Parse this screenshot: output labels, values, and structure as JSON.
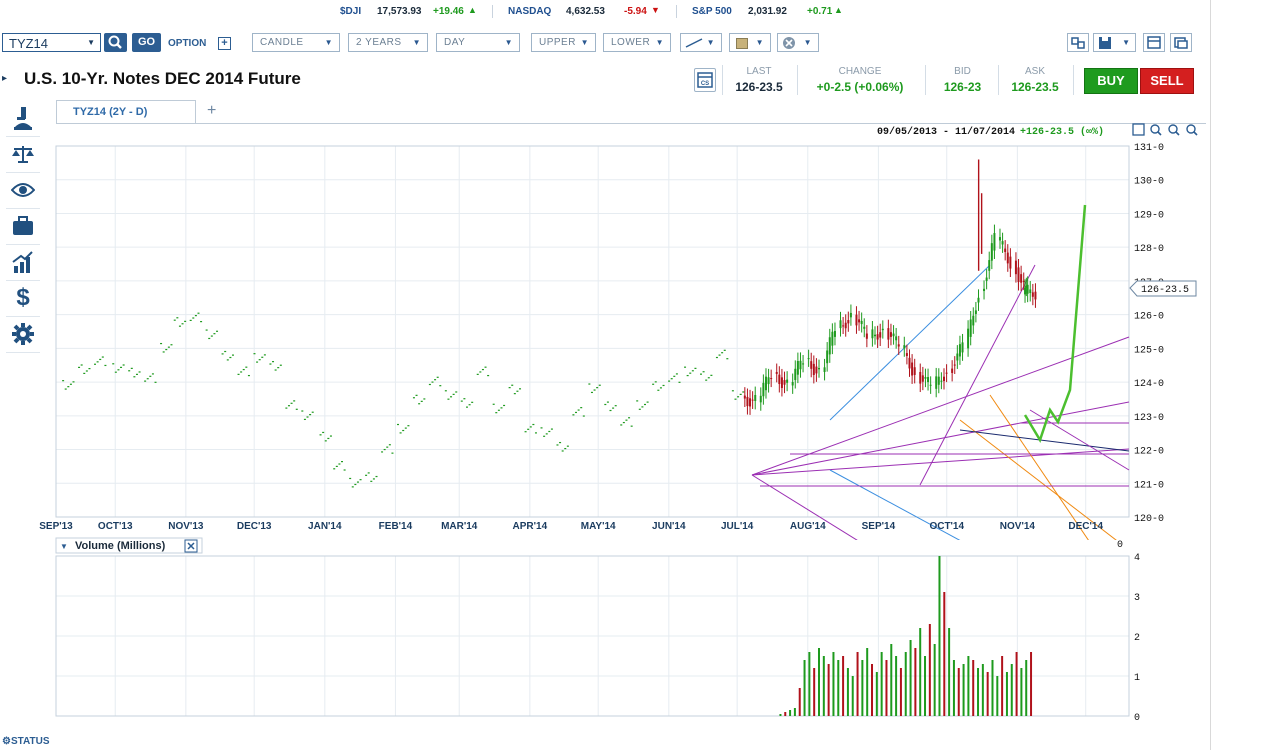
{
  "ticker": [
    {
      "name": "$DJI",
      "value": "17,573.93",
      "change": "+19.46",
      "dir": "up"
    },
    {
      "name": "NASDAQ",
      "value": "4,632.53",
      "change": "-5.94",
      "dir": "down"
    },
    {
      "name": "S&P 500",
      "value": "2,031.92",
      "change": "+0.71",
      "dir": "up"
    }
  ],
  "toolbar": {
    "symbol": "TYZ14",
    "go_label": "GO",
    "option_label": "OPTION",
    "chart_type": "CANDLE",
    "range": "2 YEARS",
    "interval": "DAY",
    "upper": "UPPER",
    "lower": "LOWER"
  },
  "instrument": {
    "title": "U.S. 10-Yr. Notes DEC 2014 Future",
    "last_label": "LAST",
    "last": "126-23.5",
    "change_label": "CHANGE",
    "change": "+0-2.5 (+0.06%)",
    "bid_label": "BID",
    "bid": "126-23",
    "ask_label": "ASK",
    "ask": "126-23.5",
    "buy_label": "BUY",
    "sell_label": "SELL",
    "cs_icon_label": "CS"
  },
  "tabs": {
    "active": "TYZ14 (2Y - D)",
    "add_label": "+"
  },
  "chart": {
    "date_range": "09/05/2013 - 11/07/2014",
    "last_change": "+126-23.5 (∞%)",
    "price_marker": "126-23.5",
    "y_ticks": [
      "131-0",
      "130-0",
      "129-0",
      "128-0",
      "127-0",
      "126-0",
      "125-0",
      "124-0",
      "123-0",
      "122-0",
      "121-0",
      "120-0"
    ],
    "x_ticks": [
      "SEP'13",
      "OCT'13",
      "NOV'13",
      "DEC'13",
      "JAN'14",
      "FEB'14",
      "MAR'14",
      "APR'14",
      "MAY'14",
      "JUN'14",
      "JUL'14",
      "AUG'14",
      "SEP'14",
      "OCT'14",
      "NOV'14",
      "DEC'14"
    ],
    "colors": {
      "up": "#1e9a1e",
      "down": "#b0121b",
      "buy": "#1f9b1f",
      "sell": "#d41f1f",
      "accent": "#2c5d92"
    }
  },
  "volume": {
    "title": "Volume (Millions)",
    "corner_value": "0",
    "y_ticks": [
      "4",
      "3",
      "2",
      "1",
      "0"
    ]
  },
  "status_label": "STATUS",
  "chart_data": [
    {
      "type": "candlestick",
      "title": "U.S. 10-Yr. Notes DEC 2014 Future",
      "ylim": [
        120,
        131
      ],
      "xlim": [
        "2013-09-05",
        "2014-12-20"
      ],
      "x_ticks": [
        "SEP'13",
        "OCT'13",
        "NOV'13",
        "DEC'13",
        "JAN'14",
        "FEB'14",
        "MAR'14",
        "APR'14",
        "MAY'14",
        "JUN'14",
        "JUL'14",
        "AUG'14",
        "SEP'14",
        "OCT'14",
        "NOV'14",
        "DEC'14"
      ],
      "series": [
        {
          "points": [
            [
              "2013-09-09",
              123.9
            ],
            [
              "2013-09-16",
              124.4
            ],
            [
              "2013-09-23",
              124.6
            ],
            [
              "2013-10-01",
              124.4
            ],
            [
              "2013-10-08",
              124.3
            ],
            [
              "2013-10-15",
              124.1
            ],
            [
              "2013-10-22",
              125.0
            ],
            [
              "2013-10-28",
              125.8
            ],
            [
              "2013-11-04",
              125.9
            ],
            [
              "2013-11-11",
              125.4
            ],
            [
              "2013-11-18",
              124.8
            ],
            [
              "2013-11-25",
              124.3
            ],
            [
              "2013-12-02",
              124.7
            ],
            [
              "2013-12-09",
              124.5
            ],
            [
              "2013-12-16",
              123.3
            ],
            [
              "2013-12-23",
              123.0
            ],
            [
              "2013-12-31",
              122.4
            ],
            [
              "2014-01-06",
              121.5
            ],
            [
              "2014-01-13",
              121.0
            ],
            [
              "2014-01-20",
              121.2
            ],
            [
              "2014-01-27",
              122.0
            ],
            [
              "2014-02-03",
              122.6
            ],
            [
              "2014-02-10",
              123.5
            ],
            [
              "2014-02-17",
              124.0
            ],
            [
              "2014-02-24",
              123.6
            ],
            [
              "2014-03-03",
              123.4
            ],
            [
              "2014-03-10",
              124.3
            ],
            [
              "2014-03-17",
              123.2
            ],
            [
              "2014-03-24",
              123.8
            ],
            [
              "2014-03-31",
              122.6
            ],
            [
              "2014-04-07",
              122.5
            ],
            [
              "2014-04-14",
              122.1
            ],
            [
              "2014-04-21",
              123.1
            ],
            [
              "2014-04-28",
              123.8
            ],
            [
              "2014-05-05",
              123.3
            ],
            [
              "2014-05-12",
              122.8
            ],
            [
              "2014-05-19",
              123.3
            ],
            [
              "2014-05-26",
              123.9
            ],
            [
              "2014-06-02",
              124.1
            ],
            [
              "2014-06-09",
              124.3
            ],
            [
              "2014-06-16",
              124.2
            ],
            [
              "2014-06-23",
              124.8
            ],
            [
              "2014-06-30",
              123.6
            ],
            [
              "2014-07-07",
              123.4
            ],
            [
              "2014-07-14",
              124.3
            ],
            [
              "2014-07-21",
              123.9
            ],
            [
              "2014-07-28",
              124.7
            ],
            [
              "2014-08-04",
              124.3
            ],
            [
              "2014-08-11",
              125.6
            ],
            [
              "2014-08-18",
              126.0
            ],
            [
              "2014-08-25",
              125.3
            ],
            [
              "2014-09-01",
              125.6
            ],
            [
              "2014-09-08",
              125.0
            ],
            [
              "2014-09-15",
              124.3
            ],
            [
              "2014-09-22",
              123.8
            ],
            [
              "2014-09-29",
              124.4
            ],
            [
              "2014-10-06",
              125.0
            ],
            [
              "2014-10-13",
              126.7
            ],
            [
              "2014-10-20",
              128.2
            ],
            [
              "2014-10-27",
              127.6
            ],
            [
              "2014-11-03",
              126.6
            ],
            [
              "2014-11-07",
              126.7
            ]
          ]
        }
      ]
    },
    {
      "type": "bar",
      "title": "Volume (Millions)",
      "ylim": [
        0,
        4
      ],
      "values": [
        0.05,
        0.1,
        0.15,
        0.2,
        0.7,
        1.4,
        1.6,
        1.2,
        1.7,
        1.5,
        1.3,
        1.6,
        1.4,
        1.5,
        1.2,
        1.0,
        1.6,
        1.4,
        1.7,
        1.3,
        1.1,
        1.6,
        1.4,
        1.8,
        1.5,
        1.2,
        1.6,
        1.9,
        1.7,
        2.2,
        1.5,
        2.3,
        1.8,
        4.0,
        3.1,
        2.2,
        1.4,
        1.2,
        1.3,
        1.5,
        1.4,
        1.2,
        1.3,
        1.1,
        1.4,
        1.0,
        1.5,
        1.1,
        1.3,
        1.6,
        1.2,
        1.4,
        1.6
      ]
    }
  ]
}
